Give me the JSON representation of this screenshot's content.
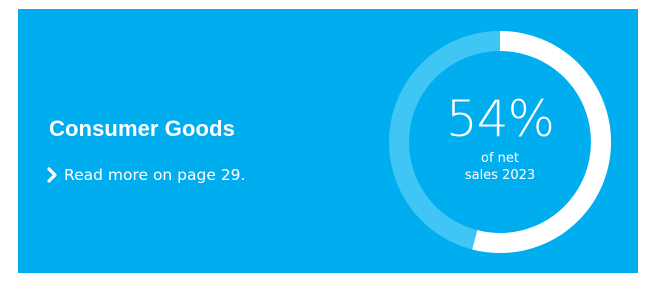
{
  "segment": {
    "title": "Consumer Goods",
    "read_more": "Read more on page 29."
  },
  "kpi": {
    "percentage_text": "54%",
    "value_fraction": 0.54,
    "caption_line1": "of net",
    "caption_line2": "sales 2023"
  },
  "icons": {
    "chevron": "chevron-right-icon"
  },
  "colors": {
    "background": "#00aeef",
    "ring_filled": "#ffffff",
    "ring_track": "#3fc6f5",
    "text": "#ffffff"
  }
}
